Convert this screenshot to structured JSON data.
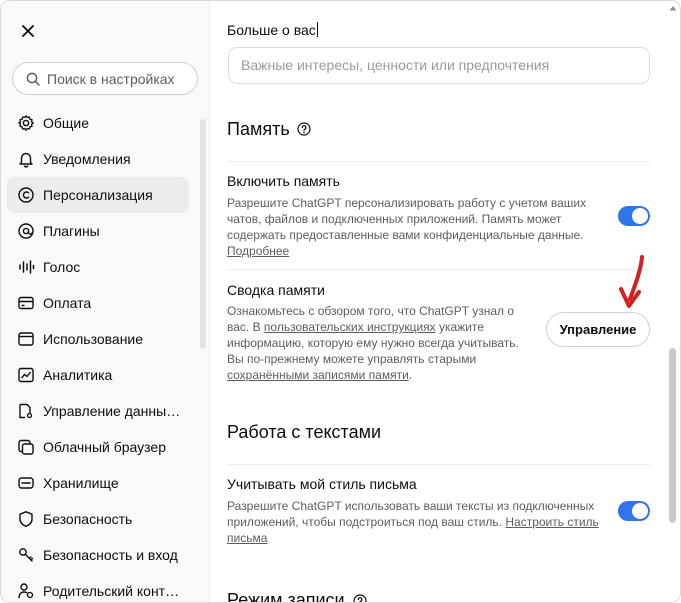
{
  "sidebar": {
    "search": {
      "placeholder": "Поиск в настройках"
    },
    "items": [
      {
        "label": "Общие",
        "icon": "gear-icon"
      },
      {
        "label": "Уведомления",
        "icon": "bell-icon"
      },
      {
        "label": "Персонализация",
        "icon": "personalization-icon",
        "active": true
      },
      {
        "label": "Плагины",
        "icon": "plugin-icon"
      },
      {
        "label": "Голос",
        "icon": "voice-waveform-icon"
      },
      {
        "label": "Оплата",
        "icon": "credit-card-icon"
      },
      {
        "label": "Использование",
        "icon": "usage-window-icon"
      },
      {
        "label": "Аналитика",
        "icon": "analytics-chart-icon"
      },
      {
        "label": "Управление данны…",
        "icon": "data-controls-icon"
      },
      {
        "label": "Облачный браузер",
        "icon": "cloud-browser-icon"
      },
      {
        "label": "Хранилище",
        "icon": "storage-icon"
      },
      {
        "label": "Безопасность",
        "icon": "shield-icon"
      },
      {
        "label": "Безопасность и вход",
        "icon": "security-login-icon"
      },
      {
        "label": "Родительский конт…",
        "icon": "parental-control-icon"
      }
    ]
  },
  "main": {
    "more_about_you": {
      "label": "Больше о вас",
      "placeholder": "Важные интересы, ценности или предпочтения"
    },
    "memory": {
      "title": "Память",
      "enable": {
        "title": "Включить память",
        "desc": "Разрешите ChatGPT персонализировать работу с учетом ваших чатов, файлов и подключенных приложений. Память может содержать предоставленные вами конфиденциальные данные.",
        "link": "Подробнее",
        "enabled": true
      },
      "summary": {
        "title": "Сводка памяти",
        "desc_part1": "Ознакомьтесь с обзором того, что ChatGPT узнал о вас. В ",
        "link1": "пользовательских инструкциях",
        "desc_part2": " укажите информацию, которую ему нужно всегда учитывать. Вы по-прежнему можете управлять старыми ",
        "link2": "сохранёнными записями памяти",
        "desc_part3": ".",
        "button": "Управление"
      }
    },
    "writing": {
      "title": "Работа с текстами",
      "style": {
        "title": "Учитывать мой стиль письма",
        "desc": "Разрешите ChatGPT использовать ваши тексты из подключенных приложений, чтобы подстроиться под ваш стиль. ",
        "link": "Настроить стиль письма",
        "enabled": true
      }
    },
    "recording": {
      "title": "Режим записи"
    }
  },
  "colors": {
    "toggle_on": "#2f74ea",
    "annotation_arrow": "#d61f1f"
  }
}
